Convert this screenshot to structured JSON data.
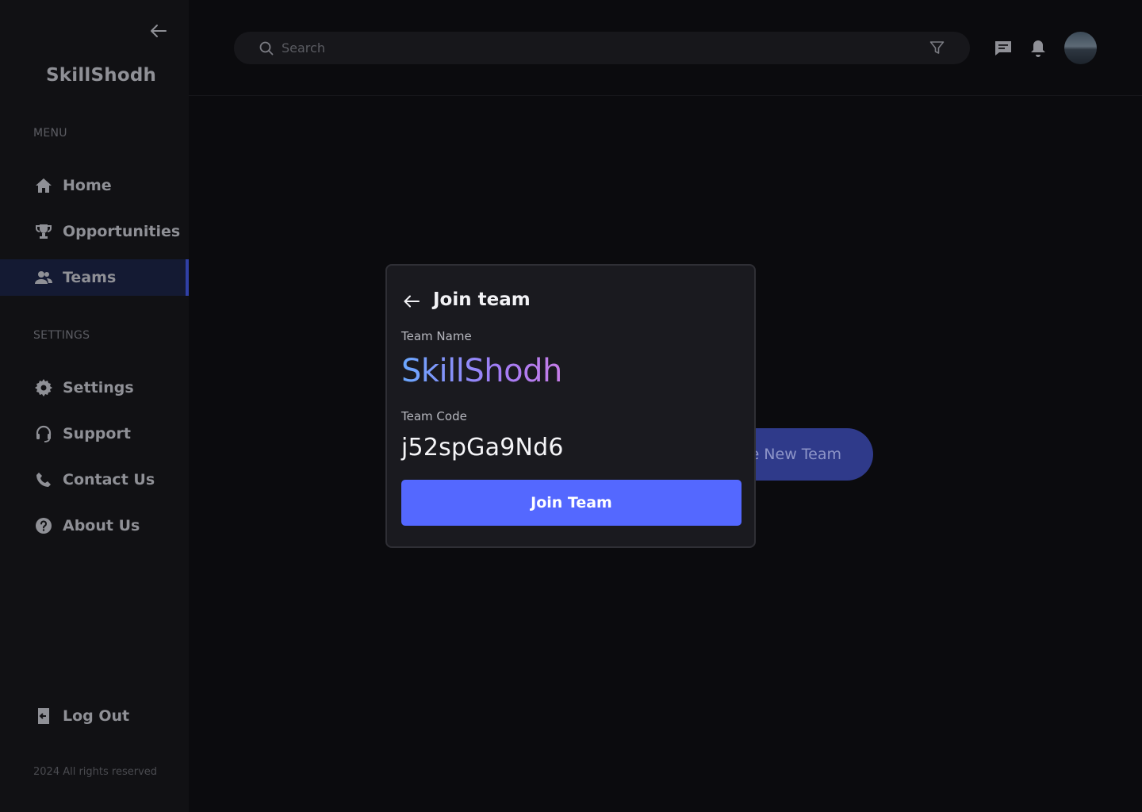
{
  "app": {
    "brand": "SkillShodh"
  },
  "sidebar": {
    "menu_label": "MENU",
    "menu_items": [
      {
        "label": "Home",
        "icon": "home-icon"
      },
      {
        "label": "Opportunities",
        "icon": "trophy-icon"
      },
      {
        "label": "Teams",
        "icon": "team-icon",
        "active": true
      }
    ],
    "settings_label": "SETTINGS",
    "settings_items": [
      {
        "label": "Settings",
        "icon": "gear-icon"
      },
      {
        "label": "Support",
        "icon": "headset-icon"
      },
      {
        "label": "Contact Us",
        "icon": "phone-icon"
      },
      {
        "label": "About Us",
        "icon": "help-circle-icon"
      }
    ],
    "logout_label": "Log Out",
    "copyright": "2024 All rights reserved"
  },
  "header": {
    "search_placeholder": "Search"
  },
  "background": {
    "create_team_label": "e New Team"
  },
  "modal": {
    "title": "Join team",
    "team_name_label": "Team Name",
    "team_name": "SkillShodh",
    "team_code_label": "Team Code",
    "team_code": "j52spGa9Nd6",
    "join_button": "Join Team"
  },
  "colors": {
    "accent": "#5468ff",
    "active_nav_border": "#3040a6",
    "gradient_start": "#6aa8ff",
    "gradient_end": "#c77de8"
  }
}
